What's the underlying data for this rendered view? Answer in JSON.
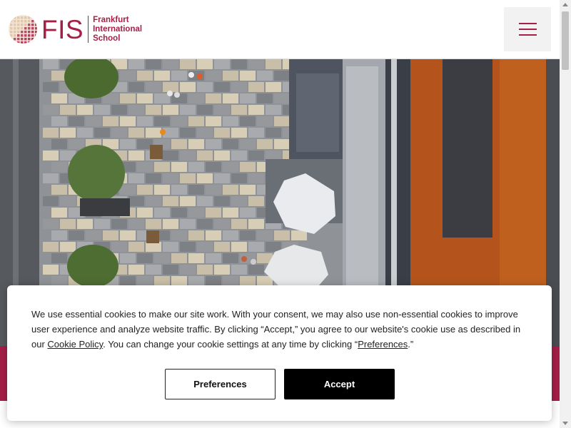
{
  "header": {
    "logo": {
      "abbr": "FIS",
      "line1": "Frankfurt",
      "line2": "International",
      "line3": "School",
      "icon": "globe-icon"
    },
    "menu_icon": "hamburger-menu-icon"
  },
  "hero": {
    "description_icon": "aerial-campus-photo"
  },
  "cookie_banner": {
    "text_part1": "We use essential cookies to make our site work. With your consent, we may also use non-essential cookies to improve user experience and analyze website traffic. By clicking “Accept,” you agree to our website's cookie use as described in our ",
    "cookie_policy_link": "Cookie Policy",
    "text_part2": ". You can change your cookie settings at any time by clicking “",
    "preferences_link": "Preferences",
    "text_part3": ".”",
    "preferences_button": "Preferences",
    "accept_button": "Accept"
  },
  "colors": {
    "brand": "#a51f47",
    "accept_bg": "#000000"
  }
}
